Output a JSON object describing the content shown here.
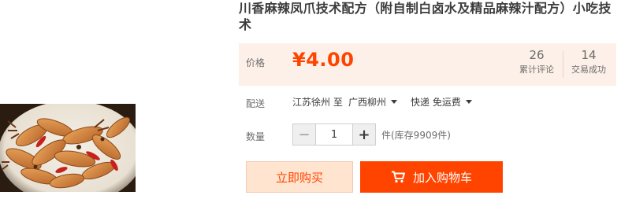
{
  "product": {
    "title": "川香麻辣凤爪技术配方（附自制白卤水及精品麻辣汁配方）小吃技术"
  },
  "price": {
    "label": "价格",
    "value": "¥4.00"
  },
  "stats": {
    "reviews_count": "26",
    "reviews_label": "累计评论",
    "trades_count": "14",
    "trades_label": "交易成功"
  },
  "shipping": {
    "label": "配送",
    "from": "江苏徐州 至",
    "to": "广西柳州",
    "method": "快递 免运费"
  },
  "quantity": {
    "label": "数量",
    "value": "1",
    "minus": "−",
    "plus": "+",
    "stock": "件(库存9909件)"
  },
  "actions": {
    "buy_now": "立即购买",
    "add_to_cart": "加入购物车"
  },
  "colors": {
    "accent": "#ff4400",
    "price_panel_bg": "#fdf0e8",
    "buy_now_bg": "#ffe4d0"
  },
  "icons": {
    "cart": "shopping-cart-icon",
    "dropdown": "chevron-down-icon"
  }
}
